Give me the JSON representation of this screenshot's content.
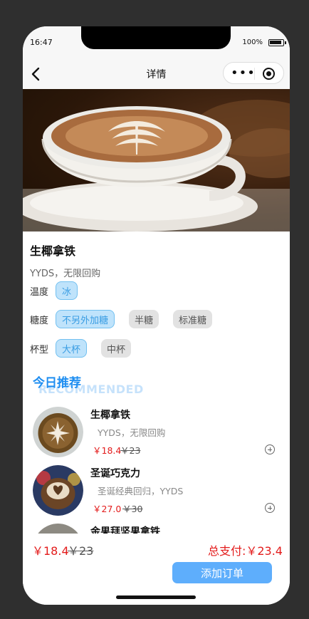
{
  "status": {
    "time": "16:47",
    "battery": "100%"
  },
  "nav": {
    "title": "详情"
  },
  "product": {
    "name": "生椰拿铁",
    "desc": "YYDS，无限回购"
  },
  "options": [
    {
      "label": "温度",
      "choices": [
        "冰"
      ],
      "selected": "冰"
    },
    {
      "label": "糖度",
      "choices": [
        "不另外加糖",
        "半糖",
        "标准糖"
      ],
      "selected": "不另外加糖"
    },
    {
      "label": "杯型",
      "choices": [
        "大杯",
        "中杯"
      ],
      "selected": "大杯"
    }
  ],
  "recommend": {
    "title": "今日推荐",
    "ghost": "RECOMMENDED",
    "items": [
      {
        "name": "生椰拿铁",
        "desc": "YYDS，无限回购",
        "price": "￥18.4",
        "old_price": "￥23"
      },
      {
        "name": "圣诞巧克力",
        "desc": "圣诞经典回归，YYDS",
        "price": "￥27.0",
        "old_price": "￥30"
      },
      {
        "name": "金果拜坚果拿铁",
        "desc": "",
        "price": "",
        "old_price": ""
      }
    ]
  },
  "footer": {
    "price": "￥18.4",
    "old_price": "￥23",
    "total": "总支付:￥23.4",
    "order_label": "添加订单"
  },
  "colors": {
    "accent": "#1f8ef1",
    "price": "#e31b1b",
    "button": "#5eaefc"
  }
}
